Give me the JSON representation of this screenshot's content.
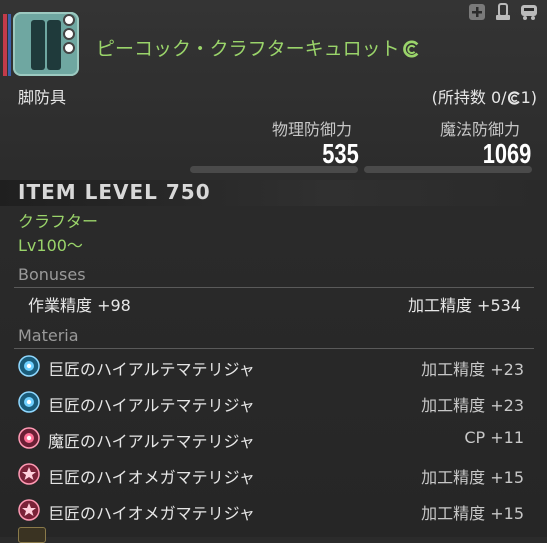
{
  "header": {
    "item_name": "ピーコック・クラフターキュロット",
    "category": "脚防具",
    "owned_label": "(所持数 0/",
    "owned_hq_count": "1)"
  },
  "stats": {
    "physical_label": "物理防御力",
    "physical_value": "535",
    "magic_label": "魔法防御力",
    "magic_value": "1069"
  },
  "item_level": "ITEM LEVEL 750",
  "requirements": {
    "class": "クラフター",
    "level": "Lv100～"
  },
  "bonuses": {
    "title": "Bonuses",
    "items": [
      {
        "text": "作業精度 +98"
      },
      {
        "text": "加工精度 +534"
      }
    ]
  },
  "materia": {
    "title": "Materia",
    "items": [
      {
        "name": "巨匠のハイアルテマテリジャ",
        "value": "加工精度 +23",
        "orb": "blue"
      },
      {
        "name": "巨匠のハイアルテマテリジャ",
        "value": "加工精度 +23",
        "orb": "blue"
      },
      {
        "name": "魔匠のハイアルテマテリジャ",
        "value": "CP +11",
        "orb": "pink"
      },
      {
        "name": "巨匠のハイオメガマテリジャ",
        "value": "加工精度 +15",
        "orb": "star"
      },
      {
        "name": "巨匠のハイオメガマテリジャ",
        "value": "加工精度 +15",
        "orb": "star"
      }
    ]
  },
  "colors": {
    "item_name": "#9ad46a",
    "background": "#2b2b2b"
  },
  "icons": [
    "plus-icon",
    "dye-icon",
    "glamour-icon",
    "hq-icon"
  ]
}
